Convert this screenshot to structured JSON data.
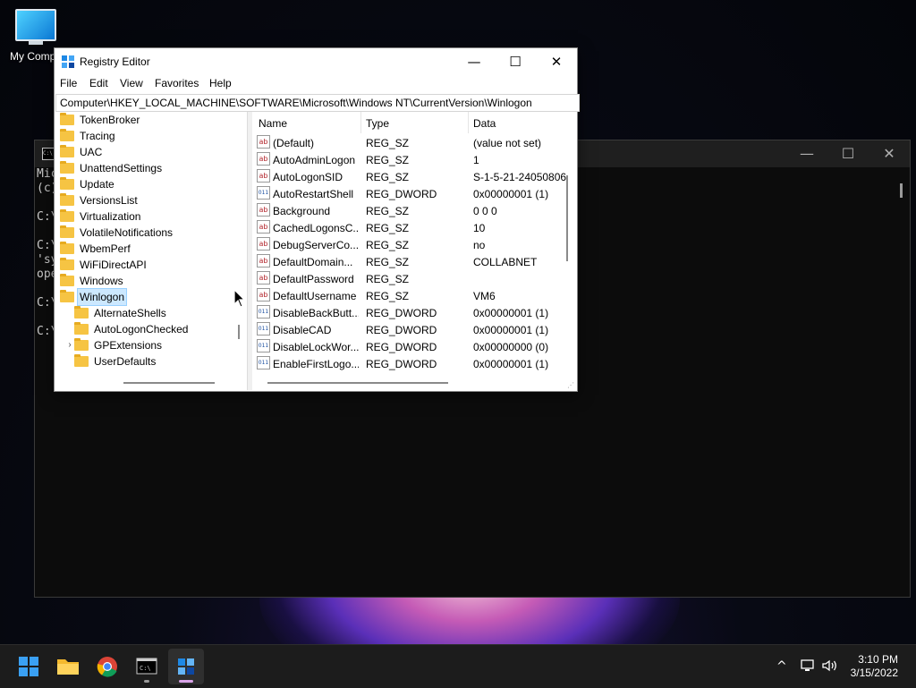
{
  "desktop": {
    "icons": [
      {
        "label": "My Compu",
        "icon": "monitor-icon"
      }
    ]
  },
  "console": {
    "lines": [
      "Mic",
      "(c)",
      "",
      "C:\\",
      "",
      "C:\\",
      "'sy",
      "ope",
      "",
      "C:\\",
      "",
      "C:\\"
    ],
    "controls": {
      "minimize": "—",
      "maximize": "☐",
      "close": "✕"
    }
  },
  "regedit": {
    "title": "Registry Editor",
    "controls": {
      "minimize": "—",
      "maximize": "☐",
      "close": "✕"
    },
    "menu": [
      "File",
      "Edit",
      "View",
      "Favorites",
      "Help"
    ],
    "address": "Computer\\HKEY_LOCAL_MACHINE\\SOFTWARE\\Microsoft\\Windows NT\\CurrentVersion\\Winlogon",
    "tree": [
      {
        "label": "TokenBroker",
        "level": 0
      },
      {
        "label": "Tracing",
        "level": 0
      },
      {
        "label": "UAC",
        "level": 0
      },
      {
        "label": "UnattendSettings",
        "level": 0
      },
      {
        "label": "Update",
        "level": 0
      },
      {
        "label": "VersionsList",
        "level": 0
      },
      {
        "label": "Virtualization",
        "level": 0
      },
      {
        "label": "VolatileNotifications",
        "level": 0
      },
      {
        "label": "WbemPerf",
        "level": 0
      },
      {
        "label": "WiFiDirectAPI",
        "level": 0
      },
      {
        "label": "Windows",
        "level": 0
      },
      {
        "label": "Winlogon",
        "level": 0,
        "selected": true,
        "expanded": true
      },
      {
        "label": "AlternateShells",
        "level": 1
      },
      {
        "label": "AutoLogonChecked",
        "level": 1
      },
      {
        "label": "GPExtensions",
        "level": 1,
        "expandable": true
      },
      {
        "label": "UserDefaults",
        "level": 1
      }
    ],
    "columns": [
      "Name",
      "Type",
      "Data"
    ],
    "values": [
      {
        "name": "(Default)",
        "type": "REG_SZ",
        "data": "(value not set)",
        "icon": "string-value-icon"
      },
      {
        "name": "AutoAdminLogon",
        "type": "REG_SZ",
        "data": "1",
        "icon": "string-value-icon"
      },
      {
        "name": "AutoLogonSID",
        "type": "REG_SZ",
        "data": "S-1-5-21-24050806",
        "icon": "string-value-icon"
      },
      {
        "name": "AutoRestartShell",
        "type": "REG_DWORD",
        "data": "0x00000001 (1)",
        "icon": "dword-value-icon"
      },
      {
        "name": "Background",
        "type": "REG_SZ",
        "data": "0 0 0",
        "icon": "string-value-icon"
      },
      {
        "name": "CachedLogonsC...",
        "type": "REG_SZ",
        "data": "10",
        "icon": "string-value-icon"
      },
      {
        "name": "DebugServerCo...",
        "type": "REG_SZ",
        "data": "no",
        "icon": "string-value-icon"
      },
      {
        "name": "DefaultDomain...",
        "type": "REG_SZ",
        "data": "COLLABNET",
        "icon": "string-value-icon"
      },
      {
        "name": "DefaultPassword",
        "type": "REG_SZ",
        "data": "",
        "icon": "string-value-icon"
      },
      {
        "name": "DefaultUsername",
        "type": "REG_SZ",
        "data": "VM6",
        "icon": "string-value-icon"
      },
      {
        "name": "DisableBackButt...",
        "type": "REG_DWORD",
        "data": "0x00000001 (1)",
        "icon": "dword-value-icon"
      },
      {
        "name": "DisableCAD",
        "type": "REG_DWORD",
        "data": "0x00000001 (1)",
        "icon": "dword-value-icon"
      },
      {
        "name": "DisableLockWor...",
        "type": "REG_DWORD",
        "data": "0x00000000 (0)",
        "icon": "dword-value-icon"
      },
      {
        "name": "EnableFirstLogo...",
        "type": "REG_DWORD",
        "data": "0x00000001 (1)",
        "icon": "dword-value-icon"
      }
    ],
    "icon_glyphs": {
      "string-value-icon": "ab",
      "dword-value-icon": "011"
    }
  },
  "taskbar": {
    "apps": [
      {
        "name": "start-button",
        "icon": "windows-logo-icon"
      },
      {
        "name": "file-explorer-button",
        "icon": "folder-icon"
      },
      {
        "name": "chrome-button",
        "icon": "chrome-icon"
      },
      {
        "name": "terminal-button",
        "icon": "terminal-icon",
        "running": true
      },
      {
        "name": "regedit-button",
        "icon": "registry-editor-icon",
        "active": true
      }
    ],
    "tray": {
      "chevron": "^",
      "time": "3:10 PM",
      "date": "3/15/2022"
    }
  },
  "colors": {
    "accent": "#0078d4",
    "selection": "#cce8ff",
    "folder": "#f6c443",
    "active_indicator": "#d9a4e8"
  }
}
